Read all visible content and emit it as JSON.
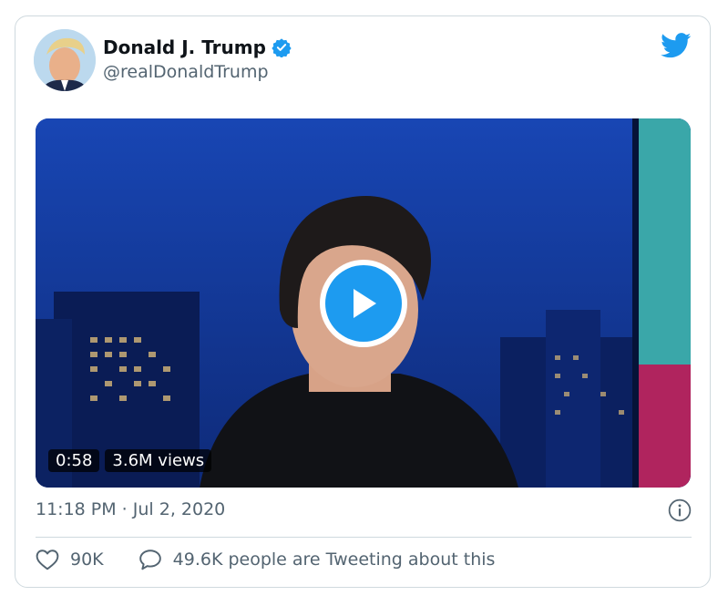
{
  "tweet": {
    "author_name": "Donald J. Trump",
    "author_handle": "@realDonaldTrump",
    "verified": true,
    "timestamp": "11:18 PM · Jul 2, 2020"
  },
  "media": {
    "type": "video",
    "duration": "0:58",
    "views": "3.6M views"
  },
  "actions": {
    "likes": "90K",
    "conversation": "49.6K people are Tweeting about this"
  },
  "icons": {
    "brand": "twitter-bird-icon",
    "verified": "verified-badge-icon",
    "play": "play-icon",
    "info": "info-icon",
    "like": "heart-icon",
    "reply": "speech-bubble-icon"
  },
  "colors": {
    "accent": "#1d9bf0",
    "text_primary": "#0f1419",
    "text_secondary": "#536471",
    "border": "#cfd9de"
  }
}
